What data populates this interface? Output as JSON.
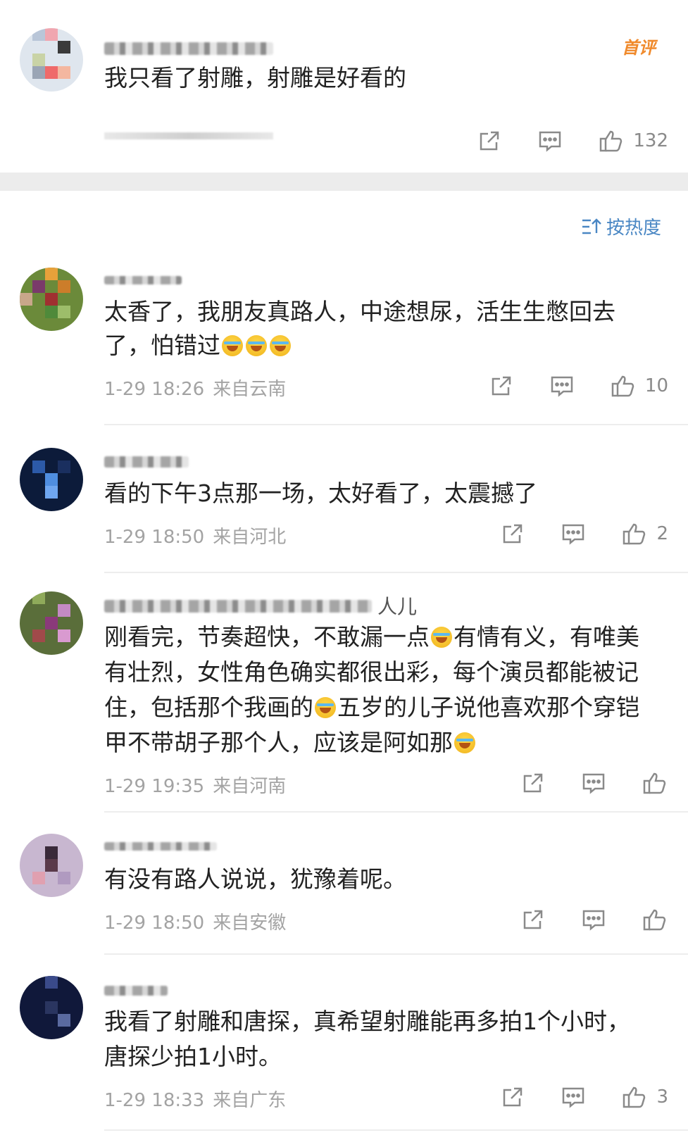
{
  "top_comment": {
    "badge": "首评",
    "text": "我只看了射雕，射雕是好看的",
    "likes": "132"
  },
  "sort": {
    "label": "按热度"
  },
  "comments": [
    {
      "username_visible": "",
      "text_lines": [
        "太香了，我朋友真路人，中途想尿，活生生憋回去",
        "了，怕错过"
      ],
      "date": "1-29 18:26",
      "location": "来自云南",
      "likes": "10"
    },
    {
      "username_visible": "",
      "text_lines": [
        "看的下午3点那一场，太好看了，太震撼了"
      ],
      "date": "1-29 18:50",
      "location": "来自河北",
      "likes": "2"
    },
    {
      "username_visible": "人儿",
      "text_lines": [
        "刚看完，节奏超快，不敢漏一点",
        "有情有义，有唯美",
        "有壮烈，女性角色确实都很出彩，每个演员都能被记",
        "住，包括那个我画的",
        "五岁的儿子说他喜欢那个穿铠",
        "甲不带胡子那个人，应该是阿如那"
      ],
      "date": "1-29 19:35",
      "location": "来自河南",
      "likes": ""
    },
    {
      "username_visible": "",
      "text_lines": [
        "有没有路人说说，犹豫着呢。"
      ],
      "date": "1-29 18:50",
      "location": "来自安徽",
      "likes": ""
    },
    {
      "username_visible": "",
      "text_lines": [
        "我看了射雕和唐探，真希望射雕能再多拍1个小时，",
        "唐探少拍1小时。"
      ],
      "date": "1-29 18:33",
      "location": "来自广东",
      "likes": "3"
    }
  ],
  "icons": {
    "share": "share-icon",
    "reply": "comment-icon",
    "like": "thumbs-up-icon"
  },
  "colors": {
    "accent_blue": "#4a87c4",
    "badge_orange": "#f08a2c",
    "meta_gray": "#a3a3a3"
  }
}
